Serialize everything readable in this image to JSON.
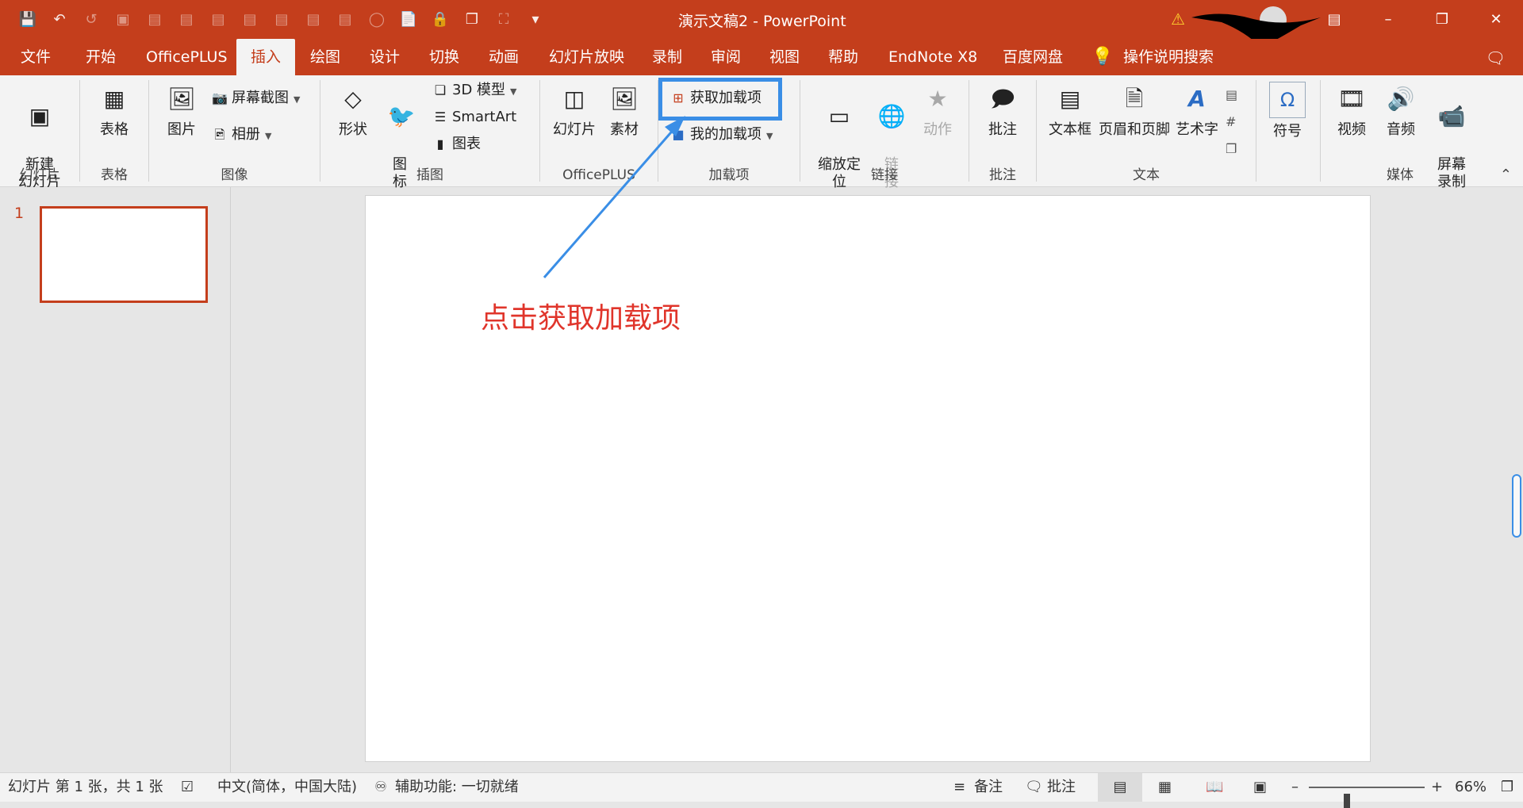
{
  "window": {
    "title": "演示文稿2 - PowerPoint",
    "qat_icons": [
      "save-icon",
      "undo-icon",
      "redo-icon",
      "present-icon",
      "align-icon",
      "align-icon",
      "align-icon",
      "align-icon",
      "align-icon",
      "align-icon",
      "align-icon",
      "align-icon",
      "shape-icon",
      "pdf-icon",
      "lock-icon",
      "copy-icon",
      "crop-icon",
      "more-icon"
    ],
    "controls": [
      "ribbon-display-icon",
      "minimize-icon",
      "restore-icon",
      "close-icon"
    ]
  },
  "tabs": [
    "文件",
    "开始",
    "OfficePLUS",
    "插入",
    "绘图",
    "设计",
    "切换",
    "动画",
    "幻灯片放映",
    "录制",
    "审阅",
    "视图",
    "帮助",
    "EndNote X8",
    "百度网盘"
  ],
  "active_tab": "插入",
  "tell_me": "操作说明搜索",
  "ribbon": {
    "slides": {
      "label": "幻灯片",
      "new_slide": "新建\n幻灯片"
    },
    "tables": {
      "label": "表格",
      "table": "表格"
    },
    "images": {
      "label": "图像",
      "pictures": "图片",
      "screenshot": "屏幕截图",
      "album": "相册"
    },
    "illustrations": {
      "label": "插图",
      "shapes": "形状",
      "icons": "图\n标",
      "models3d": "3D 模型",
      "smartart": "SmartArt",
      "chart": "图表"
    },
    "officeplus": {
      "label": "OfficePLUS",
      "slides": "幻灯片",
      "assets": "素材"
    },
    "addins": {
      "label": "加载项",
      "get_addins": "获取加载项",
      "my_addins": "我的加载项"
    },
    "links": {
      "label": "链接",
      "zoom": "缩放定\n位",
      "link": "链\n接",
      "action": "动作"
    },
    "comments": {
      "label": "批注",
      "comment": "批注"
    },
    "text": {
      "label": "文本",
      "textbox": "文本框",
      "header_footer": "页眉和页脚",
      "wordart": "艺术字"
    },
    "symbols": {
      "label": "",
      "symbol": "符号"
    },
    "media": {
      "label": "媒体",
      "video": "视频",
      "audio": "音频",
      "screen_record": "屏幕\n录制"
    }
  },
  "thumbnail": {
    "number": "1"
  },
  "annotation": "点击获取加载项",
  "status": {
    "slide_info": "幻灯片 第 1 张，共 1 张",
    "language": "中文(简体，中国大陆)",
    "accessibility": "辅助功能: 一切就绪",
    "notes": "备注",
    "comments": "批注",
    "zoom": "66%",
    "zoom_level_fraction": 0.66
  },
  "colors": {
    "brand": "#c43e1c",
    "annotation": "#e0352b",
    "highlight": "#3a8ee6"
  }
}
